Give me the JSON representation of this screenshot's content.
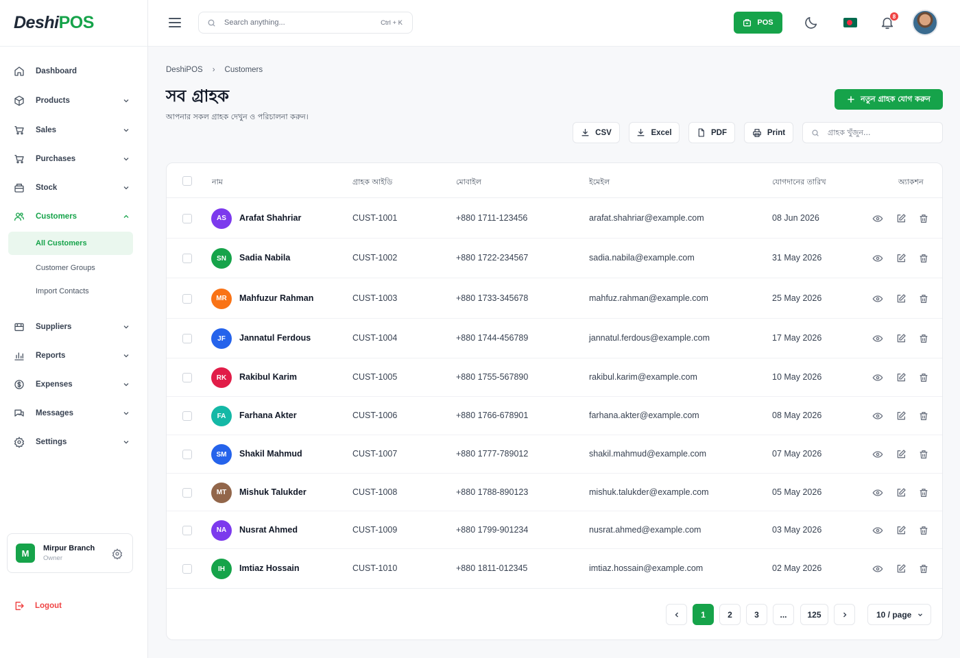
{
  "brand": {
    "name_a": "Deshi",
    "name_b": "POS"
  },
  "sidebar": {
    "items": [
      {
        "label": "Dashboard"
      },
      {
        "label": "Products"
      },
      {
        "label": "Sales"
      },
      {
        "label": "Purchases"
      },
      {
        "label": "Stock"
      },
      {
        "label": "Customers"
      },
      {
        "label": "Suppliers"
      },
      {
        "label": "Reports"
      },
      {
        "label": "Expenses"
      },
      {
        "label": "Messages"
      },
      {
        "label": "Settings"
      }
    ],
    "sub_items": [
      {
        "label": "All Customers"
      },
      {
        "label": "Customer Groups"
      },
      {
        "label": "Import Contacts"
      }
    ],
    "branch": {
      "initial": "M",
      "name": "Mirpur Branch",
      "role": "Owner"
    },
    "logout": "Logout"
  },
  "header": {
    "search_placeholder": "Search anything...",
    "shortcut": "Ctrl + K",
    "pos_label": "POS",
    "notification_count": "8"
  },
  "page": {
    "breadcrumb": [
      "DeshiPOS",
      "Customers"
    ],
    "title": "সব গ্রাহক",
    "subtitle": "আপনার সকল গ্রাহক দেখুন ও পরিচালনা করুন।",
    "add_button": "নতুন গ্রাহক যোগ করুন",
    "export": {
      "csv": "CSV",
      "excel": "Excel",
      "pdf": "PDF",
      "print": "Print"
    },
    "search_placeholder": "গ্রাহক খুঁজুন..."
  },
  "table": {
    "headers": {
      "name": "নাম",
      "id": "গ্রাহক আইডি",
      "mobile": "মোবাইল",
      "email": "ইমেইল",
      "joined": "যোগদানের তারিখ",
      "action": "অ্যাকশন"
    },
    "rows": [
      {
        "initials": "AS",
        "color": "#7c3aed",
        "name": "Arafat Shahriar",
        "id": "CUST-1001",
        "mobile": "+880 1711-123456",
        "email": "arafat.shahriar@example.com",
        "joined": "08 Jun 2026"
      },
      {
        "initials": "SN",
        "color": "#16a34a",
        "name": "Sadia Nabila",
        "id": "CUST-1002",
        "mobile": "+880 1722-234567",
        "email": "sadia.nabila@example.com",
        "joined": "31 May 2026"
      },
      {
        "initials": "MR",
        "color": "#f97316",
        "name": "Mahfuzur Rahman",
        "id": "CUST-1003",
        "mobile": "+880 1733-345678",
        "email": "mahfuz.rahman@example.com",
        "joined": "25 May 2026"
      },
      {
        "initials": "JF",
        "color": "#2563eb",
        "name": "Jannatul Ferdous",
        "id": "CUST-1004",
        "mobile": "+880 1744-456789",
        "email": "jannatul.ferdous@example.com",
        "joined": "17 May 2026"
      },
      {
        "initials": "RK",
        "color": "#e11d48",
        "name": "Rakibul Karim",
        "id": "CUST-1005",
        "mobile": "+880 1755-567890",
        "email": "rakibul.karim@example.com",
        "joined": "10 May 2026"
      },
      {
        "initials": "FA",
        "color": "#14b8a6",
        "name": "Farhana Akter",
        "id": "CUST-1006",
        "mobile": "+880 1766-678901",
        "email": "farhana.akter@example.com",
        "joined": "08 May 2026"
      },
      {
        "initials": "SM",
        "color": "#2563eb",
        "name": "Shakil Mahmud",
        "id": "CUST-1007",
        "mobile": "+880 1777-789012",
        "email": "shakil.mahmud@example.com",
        "joined": "07 May 2026"
      },
      {
        "initials": "MT",
        "color": "#92664a",
        "name": "Mishuk Talukder",
        "id": "CUST-1008",
        "mobile": "+880 1788-890123",
        "email": "mishuk.talukder@example.com",
        "joined": "05 May 2026"
      },
      {
        "initials": "NA",
        "color": "#7c3aed",
        "name": "Nusrat Ahmed",
        "id": "CUST-1009",
        "mobile": "+880 1799-901234",
        "email": "nusrat.ahmed@example.com",
        "joined": "03 May 2026"
      },
      {
        "initials": "IH",
        "color": "#16a34a",
        "name": "Imtiaz Hossain",
        "id": "CUST-1010",
        "mobile": "+880 1811-012345",
        "email": "imtiaz.hossain@example.com",
        "joined": "02 May 2026"
      }
    ]
  },
  "pagination": {
    "pages": [
      "1",
      "2",
      "3",
      "...",
      "125"
    ],
    "current": "1",
    "per_page": "10 / page"
  }
}
